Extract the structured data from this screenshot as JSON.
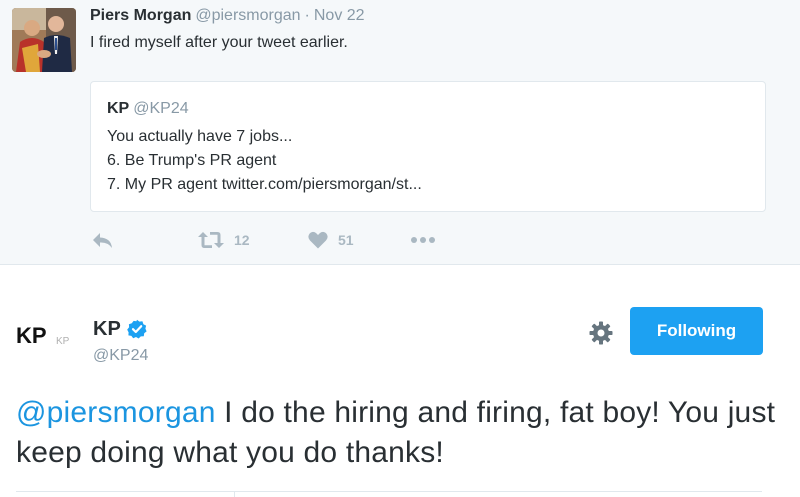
{
  "parent_tweet": {
    "author_name": "Piers Morgan",
    "author_handle": "@piersmorgan",
    "separator": "·",
    "timestamp": "Nov 22",
    "text": "I fired myself after your tweet earlier.",
    "avatar_icon": "avatar-photo",
    "quoted_tweet": {
      "author_name": "KP",
      "author_handle": "@KP24",
      "lines": [
        "You actually have 7 jobs...",
        "6. Be Trump's PR agent",
        "7. My PR agent twitter.com/piersmorgan/st..."
      ]
    },
    "actions": {
      "reply_icon": "reply-icon",
      "retweet_icon": "retweet-icon",
      "retweet_count": "12",
      "like_icon": "heart-icon",
      "like_count": "51",
      "more_icon": "more-dots-icon"
    }
  },
  "main_tweet": {
    "author_name": "KP",
    "author_handle": "@KP24",
    "verified": true,
    "avatar_logo": "KP",
    "avatar_logo_small": "KP",
    "settings_icon": "gear-icon",
    "follow_button_label": "Following",
    "mention": "@piersmorgan",
    "text": " I do the hiring and firing, fat boy! You just keep doing what you do thanks!"
  },
  "colors": {
    "accent": "#1da1f2",
    "link": "#1b95e0",
    "text": "#292f33",
    "muted": "#8899a6",
    "icon": "#aab8c2",
    "border": "#e1e8ed",
    "background_light": "#f5f8fa"
  }
}
